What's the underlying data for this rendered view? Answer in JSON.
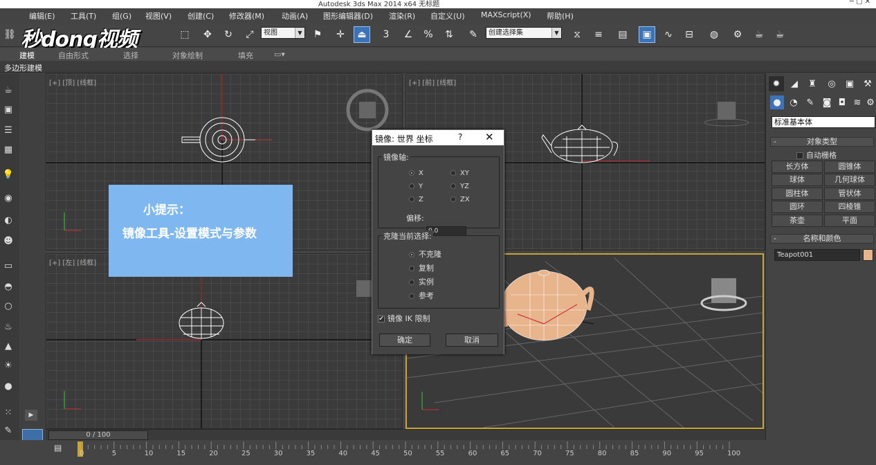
{
  "window": {
    "title": "Autodesk 3ds Max  2014 x64    无标题"
  },
  "menu": [
    "编辑(E)",
    "工具(T)",
    "组(G)",
    "视图(V)",
    "创建(C)",
    "修改器(M)",
    "动画(A)",
    "图形编辑器(D)",
    "渲染(R)",
    "自定义(U)",
    "MAXScript(X)",
    "帮助(H)"
  ],
  "toolbar": {
    "view_select": "视图",
    "selection_set": "创建选择集",
    "percent_snap": "%"
  },
  "logo": "秒dong视频",
  "ribbon": {
    "tabs": [
      "建模",
      "自由形式",
      "选择",
      "对象绘制",
      "填充"
    ],
    "sub_label": "多边形建模"
  },
  "viewports": {
    "top": "[+] [顶] [线框]",
    "front": "[+] [前] [线框]",
    "left": "[+] [左] [线框]"
  },
  "tip": {
    "title": "小提示：",
    "body": "镜像工具-设置模式与参数"
  },
  "dialog": {
    "title": "镜像: 世界 坐标",
    "help": "?",
    "close": "✕",
    "axis_group": "镜像轴:",
    "axes": [
      {
        "label": "X",
        "on": true
      },
      {
        "label": "XY",
        "on": false
      },
      {
        "label": "Y",
        "on": false
      },
      {
        "label": "YZ",
        "on": false
      },
      {
        "label": "Z",
        "on": false
      },
      {
        "label": "ZX",
        "on": false
      }
    ],
    "offset_label": "偏移:",
    "offset_value": "0.0",
    "clone_group": "克隆当前选择:",
    "clone": [
      {
        "label": "不克隆",
        "on": true
      },
      {
        "label": "复制",
        "on": false
      },
      {
        "label": "实例",
        "on": false
      },
      {
        "label": "参考",
        "on": false
      }
    ],
    "ik_label": "镜像 IK 限制",
    "ok": "确定",
    "cancel": "取消"
  },
  "cmd": {
    "category": "标准基本体",
    "object_type": "对象类型",
    "autogrid": "自动栅格",
    "objects": [
      "长方体",
      "圆锥体",
      "球体",
      "几何球体",
      "圆柱体",
      "管状体",
      "圆环",
      "四棱锥",
      "茶壶",
      "平面"
    ],
    "name_color": "名称和颜色",
    "name": "Teapot001",
    "color": "#e8b48c"
  },
  "timeline": {
    "frame": "0 / 100",
    "ticks": [
      "0",
      "5",
      "10",
      "15",
      "20",
      "25",
      "30",
      "35",
      "40",
      "45",
      "50",
      "55",
      "60",
      "65",
      "70",
      "75",
      "80",
      "85",
      "90",
      "95",
      "100"
    ]
  }
}
